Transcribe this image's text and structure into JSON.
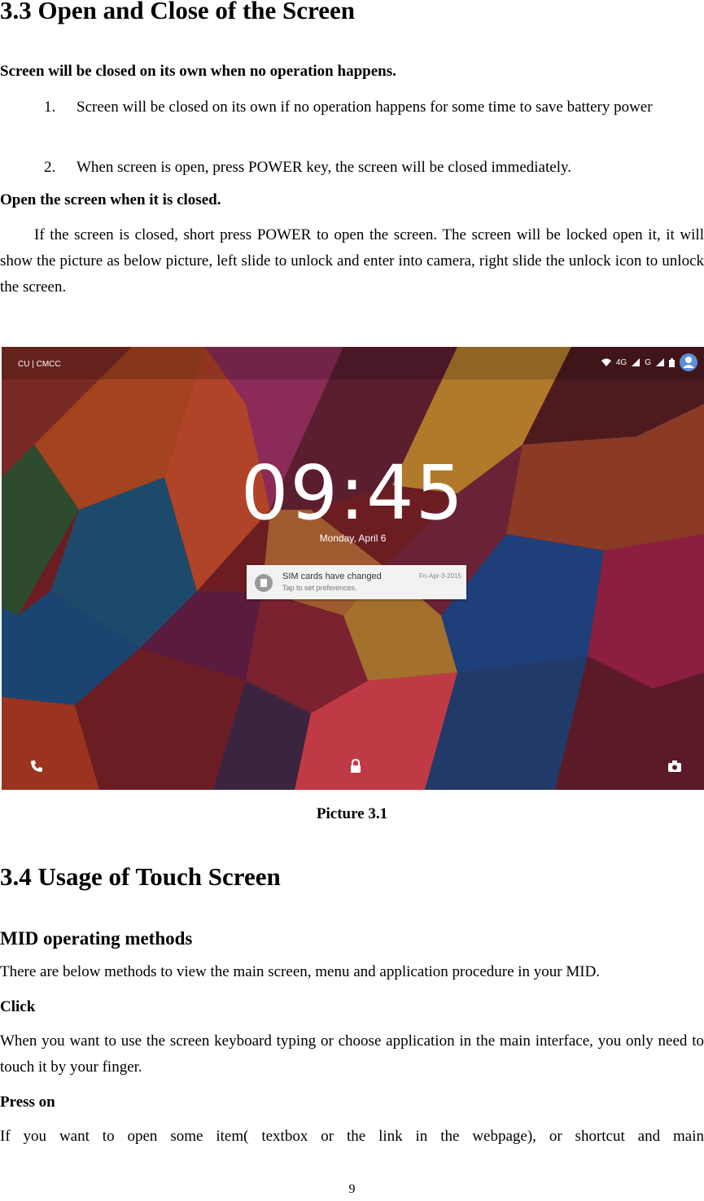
{
  "section_33": {
    "title": "3.3 Open and Close of the Screen",
    "sub1": "Screen will be closed on its own when no operation happens.",
    "items": [
      {
        "num": "1.",
        "text": "Screen will be closed on its own if no operation happens for some time to save battery power"
      },
      {
        "num": "2.",
        "text": "When screen is open, press POWER key, the screen will be closed immediately."
      }
    ],
    "sub2": "Open the screen when it is closed.",
    "para": "If the screen is closed, short press POWER to open the screen. The screen will be locked open it, it will show the picture as below picture, left slide to unlock and enter into camera, right slide the unlock icon to unlock the screen."
  },
  "figure": {
    "carrier": "CU | CMCC",
    "network": "4G",
    "network2": "G",
    "clock": "09:45",
    "date": "Monday, April 6",
    "notification_title": "SIM cards have changed",
    "notification_sub": "Tap to set preferences.",
    "notification_time": "Fri-Apr-3-2015",
    "icons": {
      "wifi": "wifi-icon",
      "signal": "signal-icon",
      "battery": "battery-icon",
      "user": "user-icon",
      "phone": "phone-icon",
      "lock": "lock-icon",
      "camera": "camera-icon"
    },
    "caption": "Picture 3.1"
  },
  "section_34": {
    "title": "3.4 Usage of Touch Screen",
    "subtitle": "MID operating methods",
    "intro": "There are below methods to view the main screen, menu and application procedure in your MID.",
    "click_heading": "Click",
    "click_text": "When you want to use the screen keyboard typing or choose application in the main interface, you only need to touch it by your finger.",
    "press_heading": "Press on",
    "press_text": "If you want to open some item( textbox or the link in the webpage), or shortcut and main"
  },
  "page_number": "9"
}
